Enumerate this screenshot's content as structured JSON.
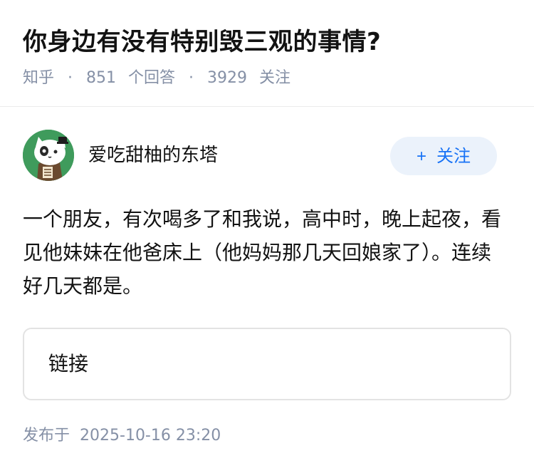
{
  "question": {
    "title": "你身边有没有特别毁三观的事情?",
    "source": "知乎",
    "answers_count": "851",
    "answers_label": "个回答",
    "followers_count": "3929",
    "followers_label": "关注",
    "separator": "·"
  },
  "answer": {
    "author_name": "爱吃甜柚的东塔",
    "follow_plus": "+",
    "follow_label": "关注",
    "content": "一个朋友，有次喝多了和我说，高中时，晚上起夜，看见他妹妹在他爸床上（他妈妈那几天回娘家了）。连续好几天都是。",
    "link_label": "链接",
    "published_label": "发布于",
    "published_time": "2025-10-16 23:20"
  },
  "colors": {
    "accent": "#1772f6",
    "follow_bg": "#ebf2fb",
    "meta_text": "#8590a6",
    "avatar_bg": "#3f9b5c"
  },
  "icons": {
    "avatar": "cartoon-cat-avatar"
  }
}
